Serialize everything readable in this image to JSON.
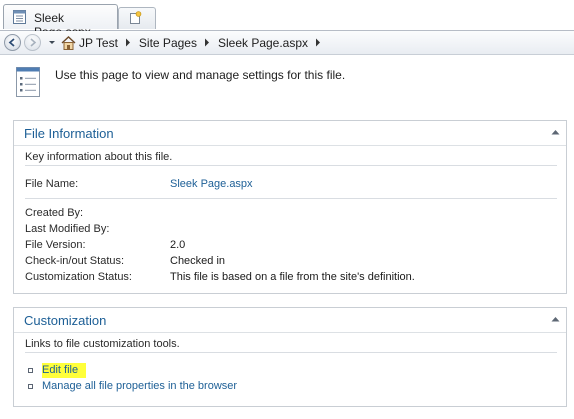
{
  "browser": {
    "active_tab_title": "Sleek Page.aspx",
    "breadcrumb": [
      "JP Test",
      "Site Pages",
      "Sleek Page.aspx"
    ]
  },
  "page": {
    "intro": "Use this page to view and manage settings for this file."
  },
  "file_information": {
    "title": "File Information",
    "description": "Key information about this file.",
    "file_name_label": "File Name:",
    "file_name_value": "Sleek Page.aspx",
    "fields": [
      {
        "label": "Created By:",
        "value": ""
      },
      {
        "label": "Last Modified By:",
        "value": ""
      },
      {
        "label": "File Version:",
        "value": "2.0"
      },
      {
        "label": "Check-in/out Status:",
        "value": "Checked in"
      },
      {
        "label": "Customization Status:",
        "value": "This file is based on a file from the site's definition."
      }
    ]
  },
  "customization": {
    "title": "Customization",
    "description": "Links to file customization tools.",
    "links": [
      "Edit file",
      "Manage all file properties in the browser"
    ]
  },
  "colors": {
    "link": "#1d5f96",
    "highlight": "#ffff3a",
    "panel_border": "#c9ced4"
  },
  "icons": [
    "document-tab-icon",
    "new-tab-icon",
    "back-arrow-icon",
    "forward-arrow-icon",
    "history-dropdown-icon",
    "home-icon",
    "breadcrumb-chevron-icon",
    "page-settings-icon",
    "collapse-chevron-up-icon",
    "bullet-icon"
  ]
}
